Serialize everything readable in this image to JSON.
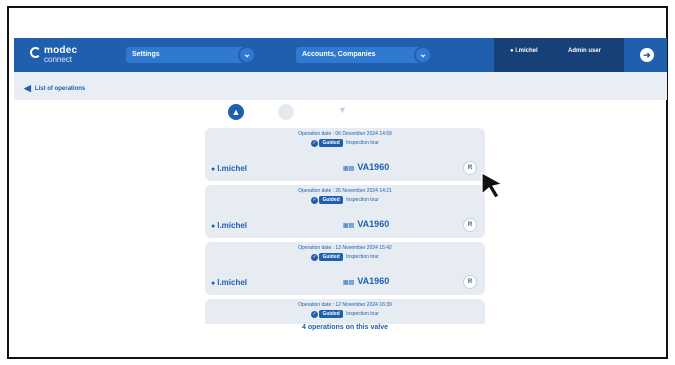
{
  "app": {
    "brand": "modec",
    "sub": "connect"
  },
  "header": {
    "settings_select": "Settings",
    "context_select": "Accounts, Companies",
    "user_name": "l.michel",
    "user_role": "Admin user"
  },
  "breadcrumb": {
    "label": "List of operations"
  },
  "operations": [
    {
      "date": "Operation date : 06 December 2024 14:59",
      "type_badge": "Guided",
      "type_label": "Inspection tour",
      "user": "l.michel",
      "valve": "VA1960",
      "action": "R"
    },
    {
      "date": "Operation date : 26 November 2024 14:21",
      "type_badge": "Guided",
      "type_label": "Inspection tour",
      "user": "l.michel",
      "valve": "VA1960",
      "action": "R"
    },
    {
      "date": "Operation date : 13 November 2024 15:42",
      "type_badge": "Guided",
      "type_label": "Inspection tour",
      "user": "l.michel",
      "valve": "VA1960",
      "action": "R"
    },
    {
      "date": "Operation date : 12 November 2024 16:39",
      "type_badge": "Guided",
      "type_label": "Inspection tour",
      "user": "",
      "valve": "",
      "action": ""
    }
  ],
  "summary": "4 operations on this valve",
  "icons": {
    "logo": "modec-logo-ring",
    "chevron": "chevron-down-icon",
    "user": "user-icon",
    "logout": "logout-icon",
    "back": "arrow-left-icon",
    "valve": "valve-icon",
    "filter": "filter-icon"
  },
  "colors": {
    "primary": "#1f5fae",
    "card": "#e6ecf2",
    "userbox": "#173f78"
  }
}
